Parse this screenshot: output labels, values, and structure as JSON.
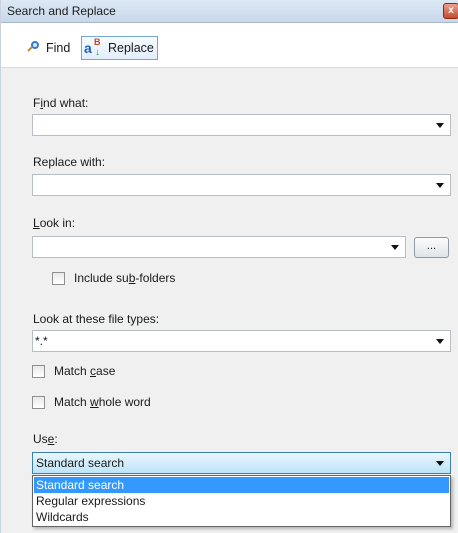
{
  "window": {
    "title": "Search and Replace",
    "close_glyph": "x"
  },
  "tabs": [
    {
      "label": "Find",
      "icon": "magnifier-icon",
      "selected": false
    },
    {
      "label": "Replace",
      "icon": "replace-icon",
      "selected": true
    }
  ],
  "find_what": {
    "label_pre": "F",
    "label_mnemonic": "i",
    "label_post": "nd what:",
    "value": ""
  },
  "replace_with": {
    "label": "Replace with:",
    "value": ""
  },
  "look_in": {
    "label_mnemonic": "L",
    "label_post": "ook in:",
    "value": "",
    "browse_label": "..."
  },
  "include_subfolders": {
    "label_pre": "Include su",
    "label_mnemonic": "b",
    "label_post": "-folders",
    "checked": false
  },
  "file_types": {
    "label": "Look at these file types:",
    "value": "*.*"
  },
  "match_case": {
    "label_pre": "Match ",
    "label_mnemonic": "c",
    "label_post": "ase",
    "checked": false
  },
  "match_whole_word": {
    "label_pre": "Match ",
    "label_mnemonic": "w",
    "label_post": "hole word",
    "checked": false
  },
  "use": {
    "label_pre": "Us",
    "label_mnemonic": "e",
    "label_post": ":",
    "selected": "Standard search",
    "options": [
      "Standard search",
      "Regular expressions",
      "Wildcards"
    ]
  },
  "colors": {
    "accent": "#3399ff",
    "titlebar": "#c8d8ea",
    "panel": "#f0f0f0"
  }
}
